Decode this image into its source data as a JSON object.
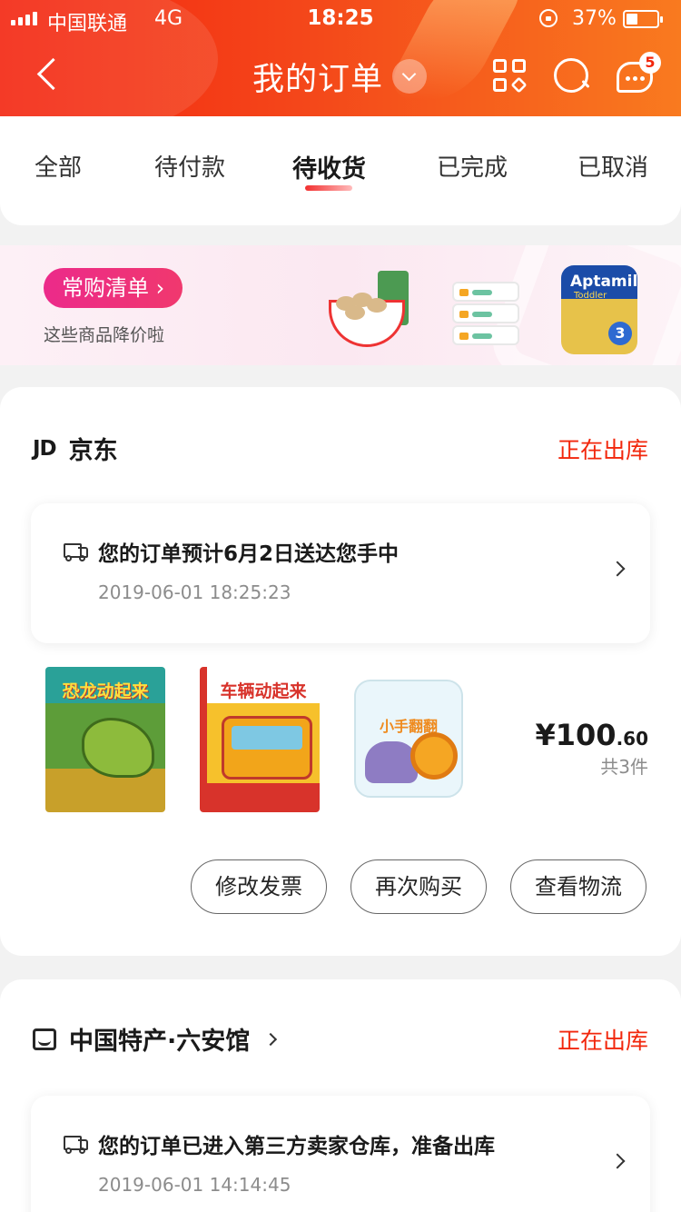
{
  "status_bar": {
    "carrier": "中国联通",
    "network": "4G",
    "time": "18:25",
    "battery": "37%"
  },
  "header": {
    "title": "我的订单",
    "message_count": "5"
  },
  "tabs": [
    {
      "label": "全部"
    },
    {
      "label": "待付款"
    },
    {
      "label": "待收货"
    },
    {
      "label": "已完成"
    },
    {
      "label": "已取消"
    }
  ],
  "active_tab": "待收货",
  "promo": {
    "button": "常购清单 ›",
    "subtitle": "这些商品降价啦",
    "aptamil_brand": "Aptamil",
    "aptamil_sub": "Toddler",
    "aptamil_stage": "3"
  },
  "orders": [
    {
      "shop": "京东",
      "shop_logo": "JD",
      "status": "正在出库",
      "track_text": "您的订单预计6月2日送达您手中",
      "track_time": "2019-06-01 18:25:23",
      "items": [
        {
          "title": "恐龙动起来"
        },
        {
          "title": "车辆动起来"
        },
        {
          "title": "小手翻翻"
        }
      ],
      "price_main": "¥100",
      "price_decimal": ".60",
      "count": "共3件",
      "buttons": [
        "修改发票",
        "再次购买",
        "查看物流"
      ]
    },
    {
      "shop": "中国特产·六安馆",
      "status": "正在出库",
      "track_text": "您的订单已进入第三方卖家仓库，准备出库",
      "track_time": "2019-06-01 14:14:45"
    }
  ],
  "colors": {
    "brand_red": "#f2270c",
    "header_gradient_start": "#f3240f",
    "header_gradient_end": "#f97a1f",
    "promo_pink": "#ec2a8a"
  }
}
